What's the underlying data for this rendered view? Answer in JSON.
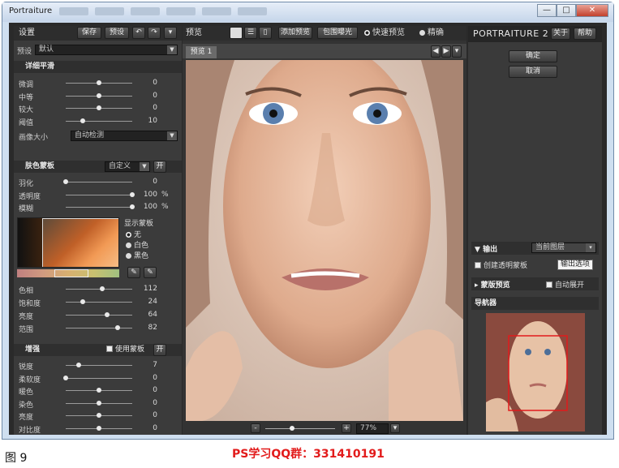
{
  "window": {
    "title": "Portraiture",
    "buttons": {
      "minimize": "—",
      "maximize": "□",
      "close": "✕"
    }
  },
  "left": {
    "header": {
      "title": "设置",
      "save": "保存",
      "preset": "预设",
      "undo": "↶",
      "redo": "↷",
      "menu": "▾"
    },
    "preset": {
      "label": "预设",
      "value": "默认"
    },
    "detail": {
      "title": "详细平滑",
      "rows": [
        {
          "label": "微调",
          "value": "0",
          "pos": 0.5
        },
        {
          "label": "中等",
          "value": "0",
          "pos": 0.5
        },
        {
          "label": "较大",
          "value": "0",
          "pos": 0.5
        },
        {
          "label": "阈值",
          "value": "10",
          "pos": 0.25
        }
      ],
      "size_label": "画像大小",
      "size_value": "自动检测"
    },
    "skin": {
      "title": "肤色蒙板",
      "mode": "自定义",
      "toggle": "开",
      "rows": [
        {
          "label": "羽化",
          "value": "0",
          "unit": "",
          "pos": 0.0
        },
        {
          "label": "透明度",
          "value": "100",
          "unit": "%",
          "pos": 1.0
        },
        {
          "label": "模糊",
          "value": "100",
          "unit": "%",
          "pos": 1.0
        }
      ],
      "show_mask": "显示蒙板",
      "options": [
        "无",
        "白色",
        "黑色"
      ],
      "hsl": [
        {
          "label": "色相",
          "value": "112",
          "pos": 0.55
        },
        {
          "label": "饱和度",
          "value": "24",
          "pos": 0.25
        },
        {
          "label": "亮度",
          "value": "64",
          "pos": 0.62
        },
        {
          "label": "范围",
          "value": "82",
          "pos": 0.78
        }
      ]
    },
    "enhance": {
      "title": "增强",
      "use_mask": "使用蒙板",
      "toggle": "开",
      "rows": [
        {
          "label": "锐度",
          "value": "7",
          "pos": 0.2
        },
        {
          "label": "柔软度",
          "value": "0",
          "pos": 0.0
        },
        {
          "label": "暖色",
          "value": "0",
          "pos": 0.5
        },
        {
          "label": "染色",
          "value": "0",
          "pos": 0.5
        },
        {
          "label": "亮度",
          "value": "0",
          "pos": 0.5
        },
        {
          "label": "对比度",
          "value": "0",
          "pos": 0.5
        }
      ]
    }
  },
  "center": {
    "title": "预览",
    "add_preview": "添加预览",
    "bracket": "包围曝光",
    "fast": "快速预览",
    "accurate": "精确",
    "tab": "预览 1",
    "zoom_minus": "-",
    "zoom_plus": "+",
    "zoom": "77%"
  },
  "right": {
    "logo_main": "PORTRAITURE",
    "logo_ver": "2",
    "about": "关于",
    "help": "帮助",
    "ok": "确定",
    "cancel": "取消",
    "output": {
      "label": "输出",
      "target": "当前图层",
      "create_mask": "创建透明蒙板",
      "tooltip": "输出选项"
    },
    "mask_preview": {
      "label": "蒙版预览",
      "auto_expand": "自动展开"
    },
    "navigator": "导航器"
  },
  "caption": {
    "figure": "图 9",
    "qq": "PS学习QQ群：331410191"
  }
}
